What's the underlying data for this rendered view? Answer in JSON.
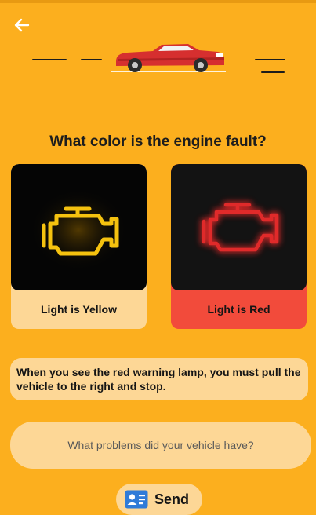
{
  "question": "What color is the engine fault?",
  "options": [
    {
      "label": "Light is Yellow",
      "icon": "engine-check-icon",
      "lamp_color": "#F5C20F"
    },
    {
      "label": "Light is Red",
      "icon": "engine-check-icon",
      "lamp_color": "#E02A2A"
    }
  ],
  "info_text": "When you see the red warning lamp, you must pull the vehicle to the right and stop.",
  "input": {
    "placeholder": "What problems did your vehicle have?",
    "value": ""
  },
  "send": {
    "label": "Send",
    "icon": "contact-card-icon"
  },
  "colors": {
    "background": "#FCAF1E",
    "option_bg": "#FDD796",
    "selected_bg": "#F24B3B",
    "car_body": "#D62F2F"
  },
  "icons": {
    "back": "arrow-left-icon",
    "header": "car-icon"
  }
}
